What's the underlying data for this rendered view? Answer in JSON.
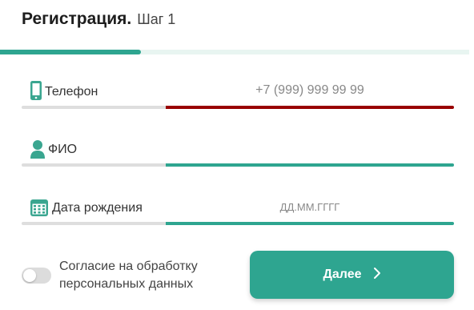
{
  "header": {
    "title": "Регистрация.",
    "step": "Шаг 1"
  },
  "progress": {
    "value_fraction": 0.3
  },
  "fields": {
    "phone": {
      "label": "Телефон",
      "placeholder": "+7 (999) 999 99 99",
      "value": "",
      "status": "error",
      "icon": "phone-icon"
    },
    "name": {
      "label": "ФИО",
      "value": "",
      "status": "ok",
      "icon": "person-icon"
    },
    "birthdate": {
      "label": "Дата рождения",
      "placeholder": "ДД.ММ.ГГГГ",
      "value": "",
      "status": "ok",
      "icon": "calendar-icon"
    }
  },
  "consent": {
    "line1": "Согласие на обработку",
    "line2": "персональных данных",
    "checked": false
  },
  "next_button": {
    "label": "Далее",
    "icon": "chevron-right-icon"
  },
  "colors": {
    "accent": "#2ea590",
    "error": "#990000",
    "icon": "#3aa690"
  }
}
